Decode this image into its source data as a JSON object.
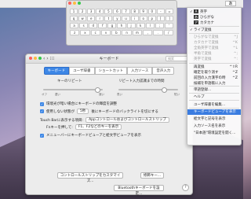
{
  "menubar": {
    "input_label": "あ",
    "apple": ""
  },
  "keyboard_viewer": {
    "rows": [
      [
        "1",
        "2",
        "3",
        "4",
        "5",
        "6",
        "7",
        "8",
        "9",
        "0",
        "-",
        "="
      ],
      [
        "q",
        "w",
        "e",
        "r",
        "t",
        "y",
        "u",
        "i",
        "o",
        "p",
        "[",
        "]"
      ],
      [
        "a",
        "s",
        "d",
        "f",
        "g",
        "h",
        "j",
        "k",
        "l",
        ";",
        "'"
      ],
      [
        "z",
        "x",
        "c",
        "v",
        "b",
        "n",
        "m",
        ",",
        ".",
        "/"
      ]
    ]
  },
  "prefs": {
    "title": "キーボード",
    "nav": "‹ › ⁝⁝⁝",
    "search_placeholder": "検索",
    "tabs": [
      "キーボード",
      "ユーザ辞書",
      "ショートカット",
      "入力ソース",
      "音声入力"
    ],
    "key_repeat_label": "キーのリピート",
    "delay_label": "リピート入力認識までの時間",
    "repeat_ticks": [
      "オフ",
      "遅い",
      "",
      "",
      "",
      "",
      "速い"
    ],
    "delay_ticks": [
      "長い",
      "",
      "",
      "",
      "短い"
    ],
    "check1": "環境光が暗い場合にキーボードの輝度を調整",
    "check2": "使用しない状態が",
    "check2_value": "5秒",
    "check2_suffix": "後にキーボードのバックライトを切にする",
    "touchbar_label": "Touch Barに表示する項目:",
    "touchbar_value": "Appコントロールおよびコントロールストリップ",
    "fn_label": "Fnキーを押して:",
    "fn_value": "F1、F2などのキーを表示",
    "check3": "メニューバーにキーボードビューアと絵文字ビューアを表示",
    "btn_control_strip": "コントロールストリップをカスタマイズ...",
    "btn_modifier": "修飾キー...",
    "btn_bluetooth": "Bluetoothキーボードを設定...",
    "help": "?"
  },
  "menu": {
    "items": [
      {
        "text": "英字",
        "shortcut": "",
        "check": "✓",
        "glyph": "A",
        "state": "normal"
      },
      {
        "text": "ひらがな",
        "shortcut": "",
        "check": "",
        "glyph": "あ",
        "state": "normal"
      },
      {
        "text": "カタカナ",
        "shortcut": "",
        "check": "",
        "glyph": "ア",
        "state": "normal"
      },
      {
        "text": "ライブ変換",
        "shortcut": "",
        "check": "✓",
        "glyph": "",
        "state": "normal"
      },
      {
        "text": "ひらがなで変換",
        "shortcut": "^J",
        "check": "",
        "glyph": "",
        "state": "disabled"
      },
      {
        "text": "カタカナで変換",
        "shortcut": "^K",
        "check": "",
        "glyph": "",
        "state": "disabled"
      },
      {
        "text": "全角英字で変換",
        "shortcut": "^L",
        "check": "",
        "glyph": "",
        "state": "disabled"
      },
      {
        "text": "半角で変換",
        "shortcut": "^;",
        "check": "",
        "glyph": "",
        "state": "disabled"
      },
      {
        "text": "英字で変換",
        "shortcut": "^:",
        "check": "",
        "glyph": "",
        "state": "disabled"
      },
      {
        "text": "再変換",
        "shortcut": "^⇧R",
        "check": "",
        "glyph": "",
        "state": "normal"
      },
      {
        "text": "確定を取り消す",
        "shortcut": "^Z",
        "check": "",
        "glyph": "",
        "state": "normal"
      },
      {
        "text": "前回の入力漢字の時",
        "shortcut": "^Z",
        "check": "",
        "glyph": "",
        "state": "normal"
      },
      {
        "text": "候補を単語帳に入力",
        "shortcut": "",
        "check": "",
        "glyph": "",
        "state": "normal"
      },
      {
        "text": "単語登録...",
        "shortcut": "",
        "check": "",
        "glyph": "",
        "state": "normal"
      },
      {
        "text": "ヘルプ",
        "shortcut": "",
        "check": "",
        "glyph": "",
        "state": "normal"
      },
      {
        "text": "ユーザ辞書を編集...",
        "shortcut": "",
        "check": "",
        "glyph": "",
        "state": "normal"
      },
      {
        "text": "キーボードビューアを表示",
        "shortcut": "",
        "check": "",
        "glyph": "",
        "state": "highlight"
      },
      {
        "text": "絵文字と記号を表示",
        "shortcut": "",
        "check": "",
        "glyph": "",
        "state": "normal"
      },
      {
        "text": "入力ソース名を表示",
        "shortcut": "",
        "check": "",
        "glyph": "",
        "state": "normal"
      },
      {
        "text": "\"日本語\"環境設定を開く...",
        "shortcut": "",
        "check": "",
        "glyph": "",
        "state": "normal"
      }
    ]
  }
}
